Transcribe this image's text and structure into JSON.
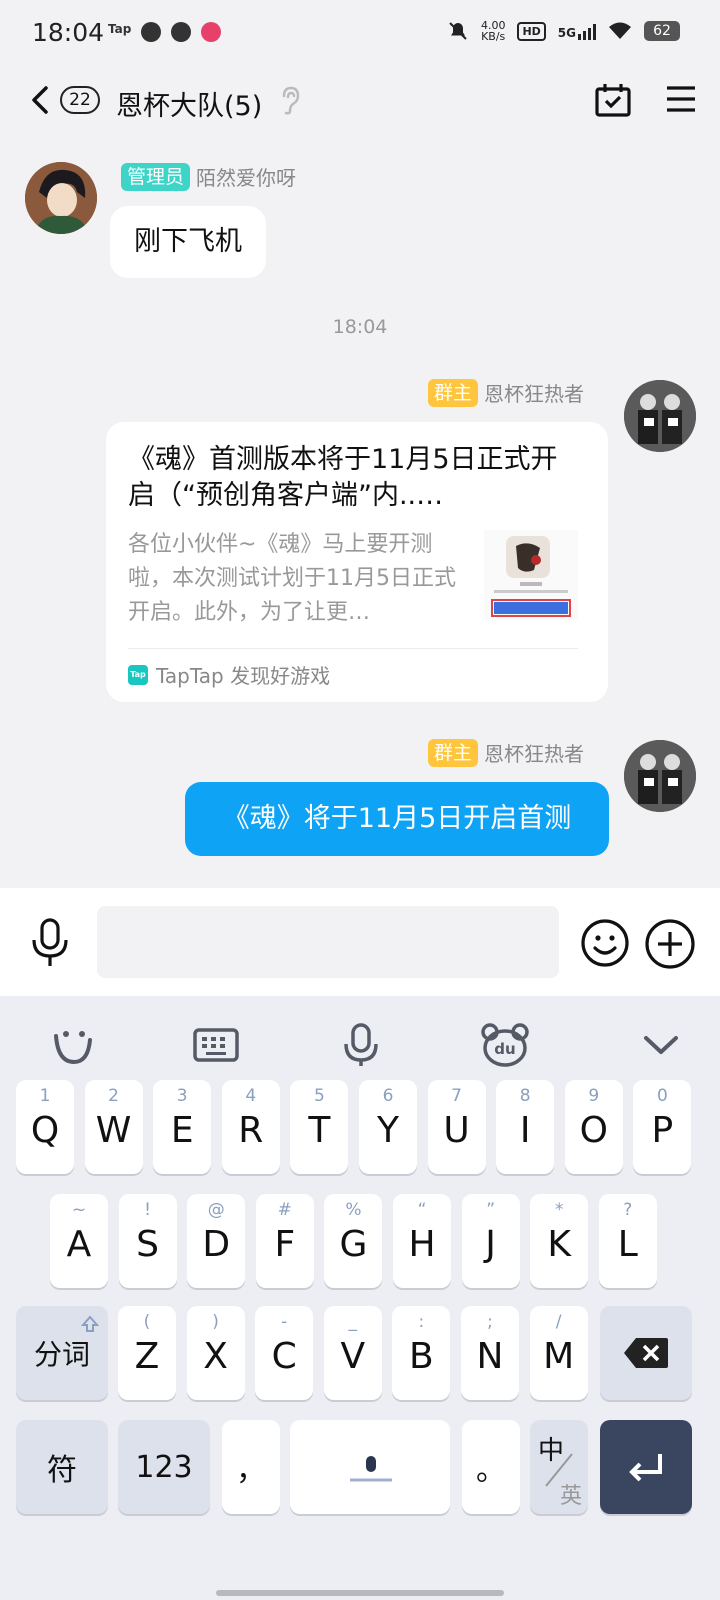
{
  "status_bar": {
    "time": "18:04",
    "app_icon_label": "Tap",
    "net_speed_value": "4.00",
    "net_speed_unit": "KB/s",
    "hd": "HD",
    "network": "5G",
    "battery": "62"
  },
  "header": {
    "unread_count": "22",
    "title": "恩杯大队(5)"
  },
  "messages": [
    {
      "role": "管理员",
      "sender": "陌然爱你呀",
      "text": "刚下飞机"
    },
    {
      "timestamp": "18:04"
    },
    {
      "role": "群主",
      "sender": "恩杯狂热者",
      "card": {
        "title": "《魂》首测版本将于11月5日正式开启（“预创角客户端”内..…",
        "description": "各位小伙伴~《魂》马上要开测啦，本次测试计划于11月5日正式开启。此外，为了让更…",
        "source": "TapTap 发现好游戏"
      }
    },
    {
      "role": "群主",
      "sender": "恩杯狂热者",
      "text": "《魂》将于11月5日开启首测"
    }
  ],
  "input": {
    "value": "",
    "placeholder": ""
  },
  "keyboard": {
    "row1": [
      {
        "alt": "1",
        "key": "Q"
      },
      {
        "alt": "2",
        "key": "W"
      },
      {
        "alt": "3",
        "key": "E"
      },
      {
        "alt": "4",
        "key": "R"
      },
      {
        "alt": "5",
        "key": "T"
      },
      {
        "alt": "6",
        "key": "Y"
      },
      {
        "alt": "7",
        "key": "U"
      },
      {
        "alt": "8",
        "key": "I"
      },
      {
        "alt": "9",
        "key": "O"
      },
      {
        "alt": "0",
        "key": "P"
      }
    ],
    "row2": [
      {
        "alt": "~",
        "key": "A"
      },
      {
        "alt": "!",
        "key": "S"
      },
      {
        "alt": "@",
        "key": "D"
      },
      {
        "alt": "#",
        "key": "F"
      },
      {
        "alt": "%",
        "key": "G"
      },
      {
        "alt": "“",
        "key": "H"
      },
      {
        "alt": "”",
        "key": "J"
      },
      {
        "alt": "*",
        "key": "K"
      },
      {
        "alt": "?",
        "key": "L"
      }
    ],
    "row3": [
      {
        "alt": "(",
        "key": "Z"
      },
      {
        "alt": ")",
        "key": "X"
      },
      {
        "alt": "-",
        "key": "C"
      },
      {
        "alt": "_",
        "key": "V"
      },
      {
        "alt": ":",
        "key": "B"
      },
      {
        "alt": ";",
        "key": "N"
      },
      {
        "alt": "/",
        "key": "M"
      }
    ],
    "shift_label": "分词",
    "symbol_label": "符",
    "number_label": "123",
    "comma_label": "，",
    "period_label": "。",
    "lang_top": "中",
    "lang_bottom": "英"
  }
}
